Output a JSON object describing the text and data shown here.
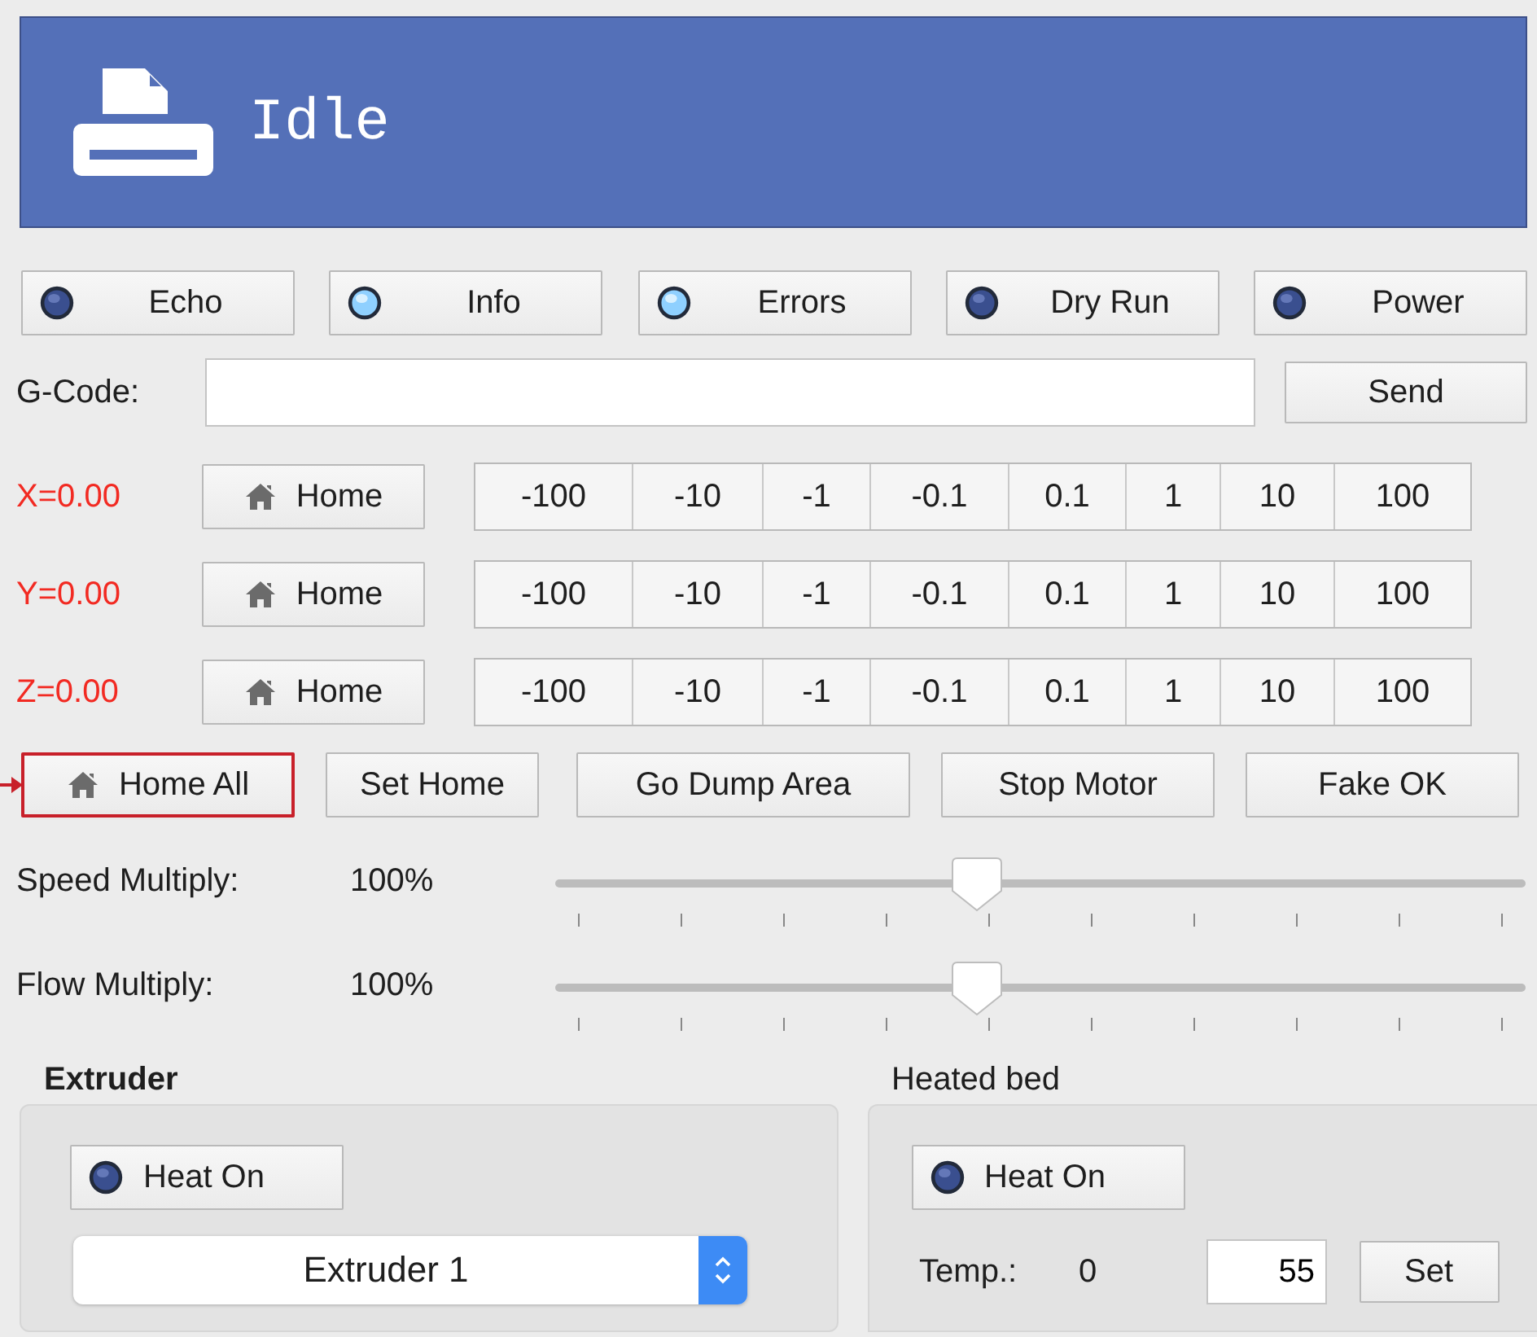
{
  "status": {
    "title": "Idle"
  },
  "toggles": [
    {
      "label": "Echo",
      "on": false
    },
    {
      "label": "Info",
      "on": true
    },
    {
      "label": "Errors",
      "on": true
    },
    {
      "label": "Dry Run",
      "on": false
    },
    {
      "label": "Power",
      "on": false
    }
  ],
  "gcode": {
    "label": "G-Code:",
    "send_button": "Send"
  },
  "axes": [
    {
      "position": "X=0.00",
      "home_button": "Home",
      "moves": [
        "-100",
        "-10",
        "-1",
        "-0.1",
        "0.1",
        "1",
        "10",
        "100"
      ]
    },
    {
      "position": "Y=0.00",
      "home_button": "Home",
      "moves": [
        "-100",
        "-10",
        "-1",
        "-0.1",
        "0.1",
        "1",
        "10",
        "100"
      ]
    },
    {
      "position": "Z=0.00",
      "home_button": "Home",
      "moves": [
        "-100",
        "-10",
        "-1",
        "-0.1",
        "0.1",
        "1",
        "10",
        "100"
      ]
    }
  ],
  "actions": [
    {
      "label": "Home All",
      "kind": "home",
      "highlighted": true
    },
    {
      "label": "Set Home",
      "kind": "plain",
      "highlighted": false
    },
    {
      "label": "Go Dump Area",
      "kind": "plain",
      "highlighted": false
    },
    {
      "label": "Stop Motor",
      "kind": "plain",
      "highlighted": false
    },
    {
      "label": "Fake OK",
      "kind": "plain",
      "highlighted": false
    }
  ],
  "sliders": [
    {
      "label": "Speed Multiply:",
      "reading": "100%",
      "level": 0.435
    },
    {
      "label": "Flow Multiply:",
      "reading": "100%",
      "level": 0.435
    }
  ],
  "extruder": {
    "title": "Extruder",
    "heat": {
      "label": "Heat On",
      "on": false
    },
    "selected_extruder": "Extruder 1"
  },
  "heated_bed": {
    "title": "Heated bed",
    "heat": {
      "label": "Heat On",
      "on": false
    },
    "temp_label": "Temp.:",
    "temp_reading": "0",
    "target": "55",
    "set_button": "Set"
  }
}
